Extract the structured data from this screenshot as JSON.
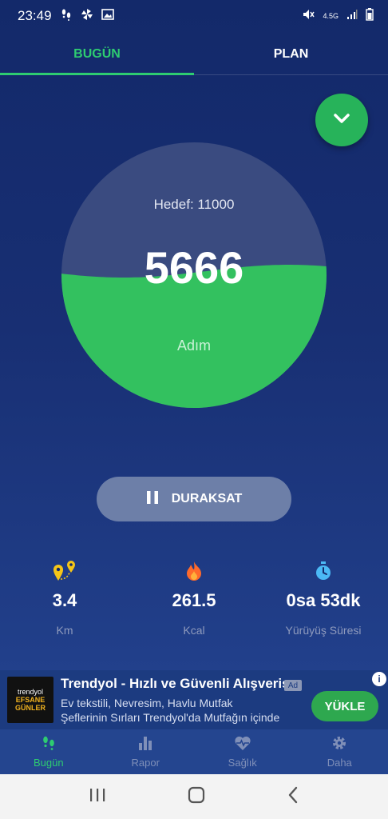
{
  "status_bar": {
    "time": "23:49",
    "left_icons": [
      "footsteps-icon",
      "pinwheel-icon",
      "image-icon"
    ],
    "right_icons": [
      "mute-icon",
      "network-4-5g-icon",
      "signal-icon",
      "battery-icon"
    ],
    "network_label": "4.5G"
  },
  "tabs": [
    {
      "label": "BUGÜN",
      "active": true
    },
    {
      "label": "PLAN",
      "active": false
    }
  ],
  "fab": {
    "icon": "chevron-down-icon"
  },
  "gauge": {
    "target": "Hedef: 11000",
    "steps": "5666",
    "unit": "Adım",
    "progress": 0.515
  },
  "pause_button": {
    "label": "DURAKSAT",
    "icon": "pause-icon"
  },
  "stats": [
    {
      "icon": "location-pins-icon",
      "value": "3.4",
      "label": "Km",
      "color": "#f5c518"
    },
    {
      "icon": "flame-icon",
      "value": "261.5",
      "label": "Kcal",
      "color": "#ff6a2b"
    },
    {
      "icon": "stopwatch-icon",
      "value": "0sa 53dk",
      "label": "Yürüyüş Süresi",
      "color": "#4bb9f5"
    }
  ],
  "ad": {
    "logo_top": "trendyol",
    "logo_bottom": "EFSANE GÜNLER",
    "title": "Trendyol - Hızlı ve Güvenli Alışveriş",
    "badge": "Ad",
    "line1": "Ev tekstili, Nevresim, Havlu Mutfak",
    "line2": "Şeflerinin Sırları Trendyol'da Mutfağın içinde",
    "cta": "YÜKLE",
    "info": "i"
  },
  "bottom_nav": [
    {
      "label": "Bugün",
      "icon": "footsteps-icon",
      "active": true
    },
    {
      "label": "Rapor",
      "icon": "bar-chart-icon",
      "active": false
    },
    {
      "label": "Sağlık",
      "icon": "heart-pulse-icon",
      "active": false
    },
    {
      "label": "Daha",
      "icon": "gear-icon",
      "active": false
    }
  ],
  "system_nav": [
    "recents-icon",
    "home-icon",
    "back-icon"
  ],
  "colors": {
    "accent": "#2ecc71",
    "background": "#182f73",
    "gauge_fill": "#33c15f"
  }
}
